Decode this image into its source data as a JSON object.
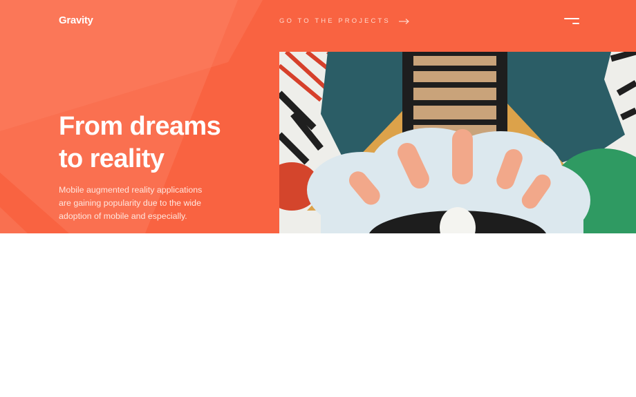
{
  "header": {
    "logo_text": "Gravity",
    "projects_link_label": "GO TO THE PROJECTS",
    "projects_link_icon": "arrow-right-icon",
    "menu_icon": "hamburger-menu-icon"
  },
  "hero": {
    "title_lines": [
      "From dreams",
      "to reality"
    ],
    "description_lines": [
      "Mobile augmented reality applications",
      "are gaining popularity due to the wide",
      "adoption of mobile and especially."
    ],
    "image": "colorful-mural-with-eye-and-ladder"
  },
  "colors": {
    "accent": "#f96341",
    "accent_light": "#fb7c5d",
    "text_on_accent": "#ffffff",
    "background": "#ffffff"
  }
}
